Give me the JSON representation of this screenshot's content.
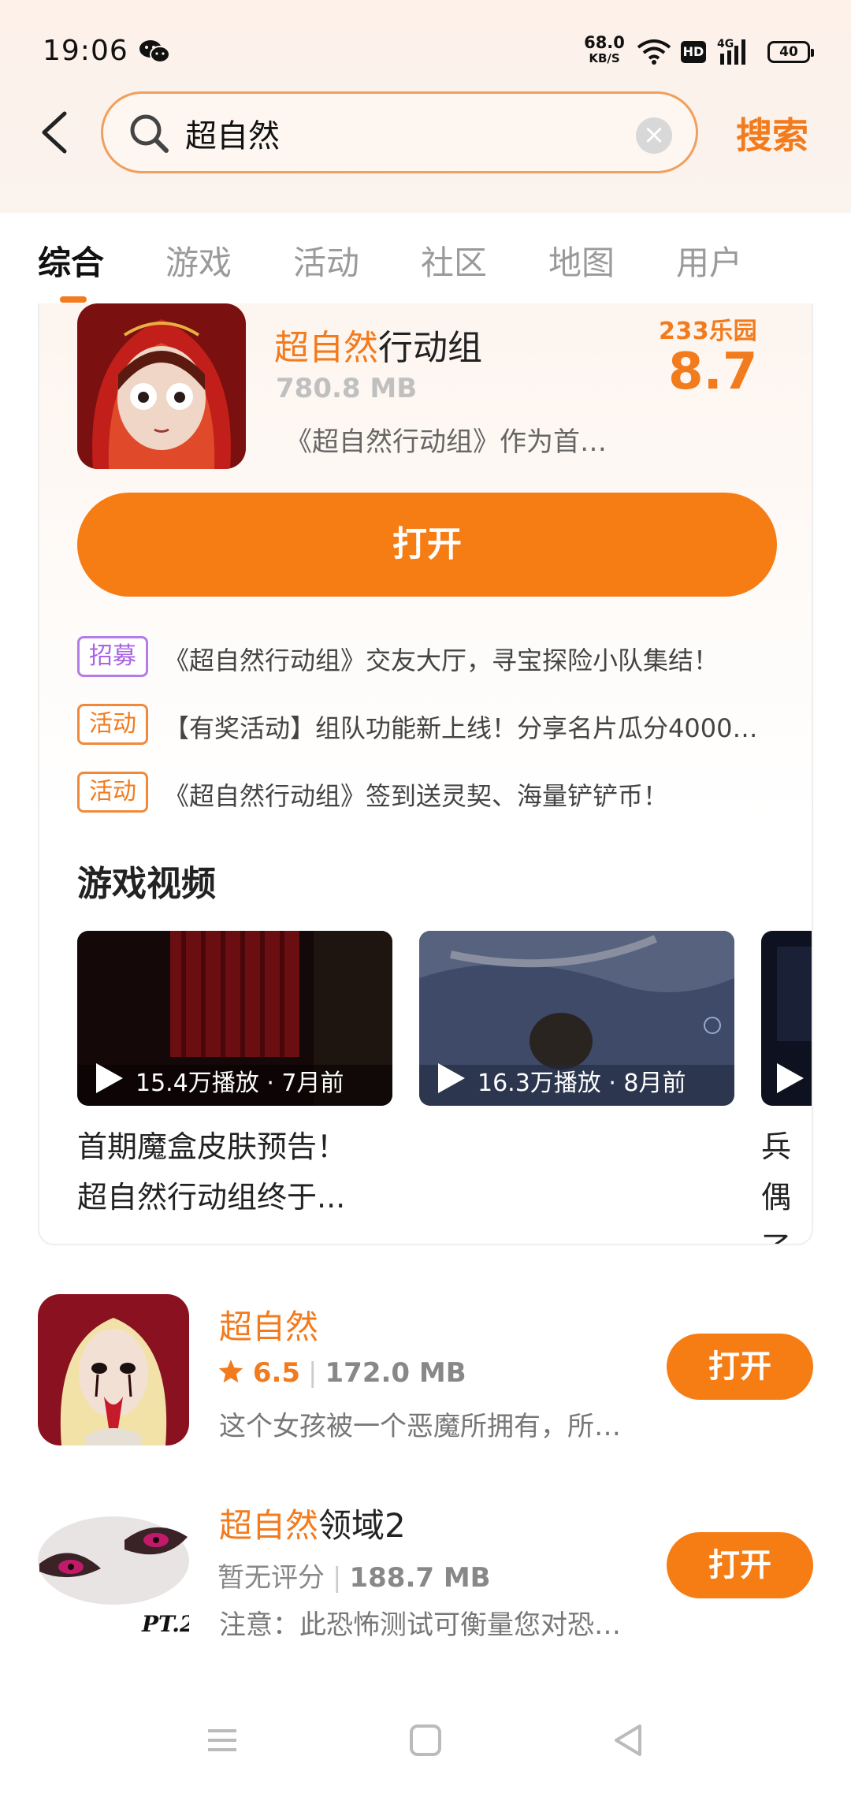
{
  "status_bar": {
    "time": "19:06",
    "net_speed": "68.0",
    "net_unit": "KB/S",
    "hd": "HD",
    "signal": "4G",
    "battery": "40",
    "icons": [
      "wechat-icon",
      "wifi-icon",
      "signal-icon",
      "battery-icon"
    ]
  },
  "search": {
    "query": "超自然",
    "button_label": "搜索"
  },
  "tabs": [
    {
      "label": "综合",
      "active": true
    },
    {
      "label": "游戏",
      "active": false
    },
    {
      "label": "活动",
      "active": false
    },
    {
      "label": "社区",
      "active": false
    },
    {
      "label": "地图",
      "active": false
    },
    {
      "label": "用户",
      "active": false
    }
  ],
  "featured": {
    "title_highlight": "超自然",
    "title_rest": "行动组",
    "size": "780.8 MB",
    "description": "《超自然行动组》作为首…",
    "rating_brand": "233乐园",
    "rating": "8.7",
    "open_label": "打开",
    "news": [
      {
        "tag": "招募",
        "text": "《超自然行动组》交友大厅，寻宝探险小队集结！"
      },
      {
        "tag": "活动",
        "text": "【有奖活动】组队功能新上线！分享名片瓜分4000…"
      },
      {
        "tag": "活动",
        "text": "《超自然行动组》签到送灵契、海量铲铲币！"
      }
    ],
    "videos_title": "游戏视频",
    "videos": [
      {
        "meta": "15.4万播放 · 7月前",
        "title_line1": "首期魔盒皮肤预告！",
        "title_line2": "超自然行动组终于..."
      },
      {
        "meta": "16.3万播放 · 8月前",
        "title_line1": "",
        "title_line2": ""
      },
      {
        "meta": "",
        "title_line1": "兵偶",
        "title_line2": "了。"
      }
    ]
  },
  "results": [
    {
      "name_highlight": "超自然",
      "name_rest": "",
      "score": "6.5",
      "size": "172.0 MB",
      "description": "这个女孩被一个恶魔所拥有，所…",
      "open_label": "打开"
    },
    {
      "name_highlight": "超自然",
      "name_rest": "领域2",
      "score_text": "暂无评分",
      "size": "188.7 MB",
      "description": "注意：此恐怖测试可衡量您对恐…",
      "open_label": "打开",
      "icon_caption": "PT.2"
    }
  ],
  "colors": {
    "accent": "#f27b1e",
    "button": "#f67c14",
    "tag_purple": "#a864e4"
  }
}
